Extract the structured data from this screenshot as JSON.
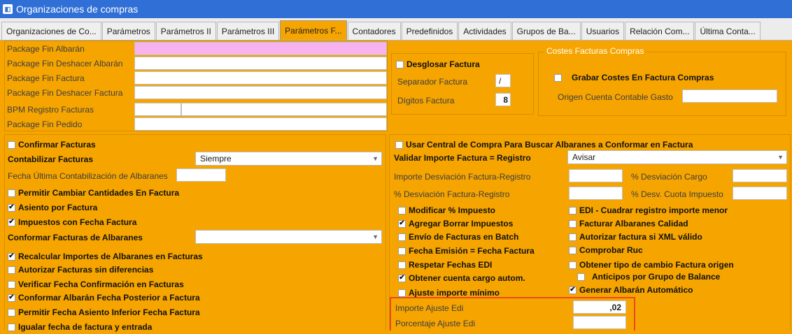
{
  "window": {
    "title": "Organizaciones de compras",
    "icon": "app-icon"
  },
  "tabs": [
    {
      "label": "Organizaciones de Co..."
    },
    {
      "label": "Parámetros"
    },
    {
      "label": "Parámetros II"
    },
    {
      "label": "Parámetros III"
    },
    {
      "label": "Parámetros F..."
    },
    {
      "label": "Contadores"
    },
    {
      "label": "Predefinidos"
    },
    {
      "label": "Actividades"
    },
    {
      "label": "Grupos de Ba..."
    },
    {
      "label": "Usuarios"
    },
    {
      "label": "Relación Com..."
    },
    {
      "label": "Última Conta..."
    }
  ],
  "packages": {
    "fin_albaran": "Package Fin Albarán",
    "fin_deshacer_albaran": "Package Fin Deshacer Albarán",
    "fin_factura": "Package Fin Factura",
    "fin_deshacer_factura": "Package Fin Deshacer Factura",
    "bpm_registro": "BPM Registro Facturas",
    "fin_pedido": "Package Fin Pedido"
  },
  "desglosar": {
    "label": "Desglosar Factura",
    "separador_label": "Separador Factura",
    "separador_value": "/",
    "digitos_label": "Dígitos Factura",
    "digitos_value": "8"
  },
  "costes": {
    "group_title": "Costes Facturas Compras",
    "grabar_label": "Grabar Costes En Factura Compras",
    "origen_label": "Origen Cuenta Contable Gasto"
  },
  "left": {
    "confirmar": "Confirmar Facturas",
    "contabilizar_label": "Contabilizar Facturas",
    "contabilizar_value": "Siempre",
    "fecha_ultima": "Fecha Última Contabilización de Albaranes",
    "permitir_cambiar": "Permitir Cambiar Cantidades En Factura",
    "asiento": "Asiento por Factura",
    "impuestos": "Impuestos con Fecha Factura",
    "conformar_label": "Conformar Facturas de Albaranes",
    "recalcular": "Recalcular Importes de Albaranes en Facturas",
    "autorizar": "Autorizar Facturas sin diferencias",
    "verificar": "Verificar Fecha Confirmación en Facturas",
    "conformar_albaran": "Conformar Albarán Fecha Posterior a Factura",
    "permitir_fecha": "Permitir Fecha Asiento Inferior Fecha Factura",
    "igualar": "Igualar fecha de factura y entrada"
  },
  "right": {
    "usar_central": "Usar Central de Compra Para Buscar Albaranes a Conformar en Factura",
    "validar_label": "Validar Importe Factura = Registro",
    "validar_value": "Avisar",
    "importe_desv": "Importe Desviación Factura-Registro",
    "pct_desv_cargo": "% Desviación Cargo",
    "pct_desv_factura": "% Desviación Factura-Registro",
    "pct_desv_cuota": "% Desv. Cuota Impuesto",
    "modificar": "Modificar % Impuesto",
    "agregar": "Agregar Borrar Impuestos",
    "envio": "Envío de Facturas en Batch",
    "fecha_emision": "Fecha Emisión = Fecha Factura",
    "respetar": "Respetar Fechas EDI",
    "obtener_cuenta": "Obtener cuenta cargo autom.",
    "ajuste_minimo": "Ajuste importe mínimo",
    "edi_cuadrar": "EDI - Cuadrar registro importe menor",
    "facturar_calidad": "Facturar Albaranes Calidad",
    "autorizar_xml": "Autorizar factura si XML válido",
    "comprobar_ruc": "Comprobar Ruc",
    "obtener_tipo": "Obtener tipo de cambio Factura origen",
    "anticipos": "Anticipos por Grupo de Balance",
    "generar": "Generar Albarán Automático",
    "importe_ajuste_label": "Importe Ajuste Edi",
    "importe_ajuste_value": ",02",
    "porcentaje_ajuste_label": "Porcentaje Ajuste Edi"
  },
  "checks": {
    "on": "✔",
    "off": ""
  }
}
